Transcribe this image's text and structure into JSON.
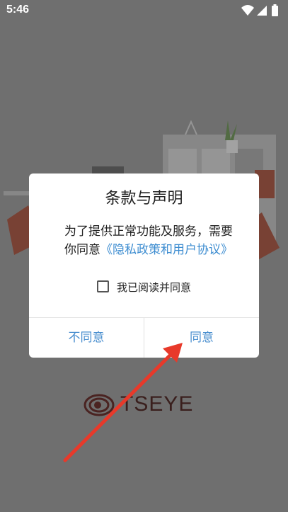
{
  "status": {
    "time": "5:46"
  },
  "logo": {
    "text": "TSEYE"
  },
  "dialog": {
    "title": "条款与声明",
    "message_prefix": "为了提供正常功能及服务，需要你同意",
    "policy_link": "《隐私政策和用户协议》",
    "checkbox_label": "我已阅读并同意",
    "checkbox_checked": false,
    "disagree_label": "不同意",
    "agree_label": "同意"
  },
  "colors": {
    "link": "#3f8ed1",
    "button_text": "#4a8fcf",
    "arrow": "#e8392a",
    "brand": "#3a1f1d"
  }
}
